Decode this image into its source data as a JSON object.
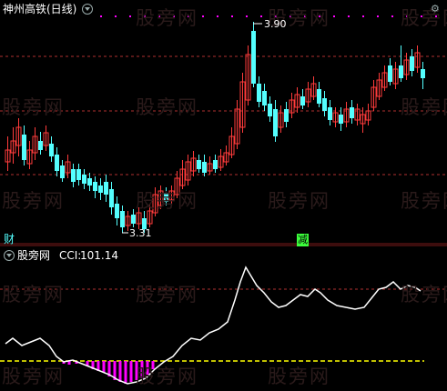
{
  "top_panel": {
    "title": "神州高铁(日线)",
    "high_marker": "3.90",
    "low_marker": "3.31",
    "tag_left": "财",
    "tag_reduce": "减",
    "corner_icon": "settings-icon"
  },
  "bottom_panel": {
    "indicator_name": "股旁网",
    "indicator_label": "CCI:",
    "indicator_value": "101.14"
  },
  "watermark": "股旁网",
  "colors": {
    "up": "#ff3b3b",
    "down": "#54ffff",
    "cci_line": "#ffffff",
    "zero_line": "#ffff00",
    "dashed_grid": "#b03030",
    "magenta": "#ff00ff",
    "reduce_tag": "#3cff3c",
    "title": "#ffffff",
    "value": "#ffffff"
  }
}
